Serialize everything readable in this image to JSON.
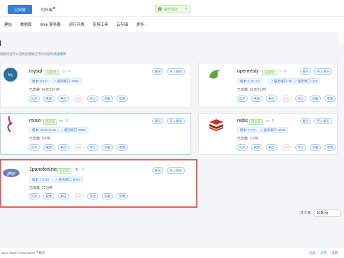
{
  "topbar": {
    "installed_tab": "已安装",
    "oss_tab": "可升级",
    "toast": "操作成功",
    "toast_close": "✕"
  },
  "nav": {
    "items": [
      "建站",
      "数据库",
      "Web 服务器",
      "运行环境",
      "实用工具",
      "云存储",
      "更多"
    ]
  },
  "hint": {
    "text": "健康检查可以避免因健康应用的问题时",
    "link": "快速跳转"
  },
  "labels": {
    "version": "版本:",
    "port": "服务端口:",
    "installed": "已安装:"
  },
  "apps": [
    {
      "name": "mysql",
      "status": "已启动",
      "version": "8.1.0",
      "port": "3306",
      "installed_for": "54天23小时",
      "top_actions": [
        "备份",
        "导入备份"
      ],
      "actions": [
        "同步",
        "重建",
        "重启",
        "启动",
        "停止",
        "卸载",
        "参数"
      ],
      "disabled": [
        3
      ]
    },
    {
      "name": "openresty",
      "status": "已启动",
      "version": "1.21.4.2",
      "port": "80",
      "port2": "443",
      "installed_for": "31天2小时",
      "top_actions": [
        "备份",
        "导入备份"
      ],
      "actions": [
        "同步",
        "重建",
        "重启",
        "启动",
        "停止",
        "卸载",
        "参数"
      ],
      "disabled": [
        3
      ]
    },
    {
      "name": "minio",
      "status": "已启动",
      "version": "2023-12-16",
      "port": "9000",
      "installed_for": "9小时",
      "top_actions": [
        "备份",
        "导入备份"
      ],
      "actions": [
        "同步",
        "重建",
        "重启",
        "启动",
        "停止",
        "卸载",
        "参数"
      ],
      "disabled": [
        3
      ]
    },
    {
      "name": "redis",
      "status": "已启动",
      "version": "7.2.3",
      "port": "6379",
      "installed_for": "1小时",
      "top_actions": [
        "备份",
        "导入备份"
      ],
      "actions": [
        "同步",
        "重建",
        "重启",
        "启动",
        "停止",
        "卸载",
        "参数"
      ],
      "disabled": [
        3
      ]
    },
    {
      "name": "1panelonline",
      "status": "已启动",
      "version": "7.4.33",
      "port": "9002",
      "installed_for": "27分钟",
      "top_actions": [
        "备份",
        "导入备份"
      ],
      "actions": [
        "同步",
        "重建",
        "重启",
        "启动",
        "停止",
        "卸载",
        "参数"
      ],
      "disabled": [
        3
      ]
    }
  ],
  "pager": {
    "total": "共 5 条",
    "page_size": "20条/页"
  },
  "footer": {
    "copyright": "2014-2023 FIT2CLOUD 飞致云",
    "links": [
      "论坛",
      "文档",
      "当前"
    ]
  },
  "colors": {
    "accent": "#3a7bd5",
    "success": "#67c23a",
    "highlight": "#e06666"
  }
}
